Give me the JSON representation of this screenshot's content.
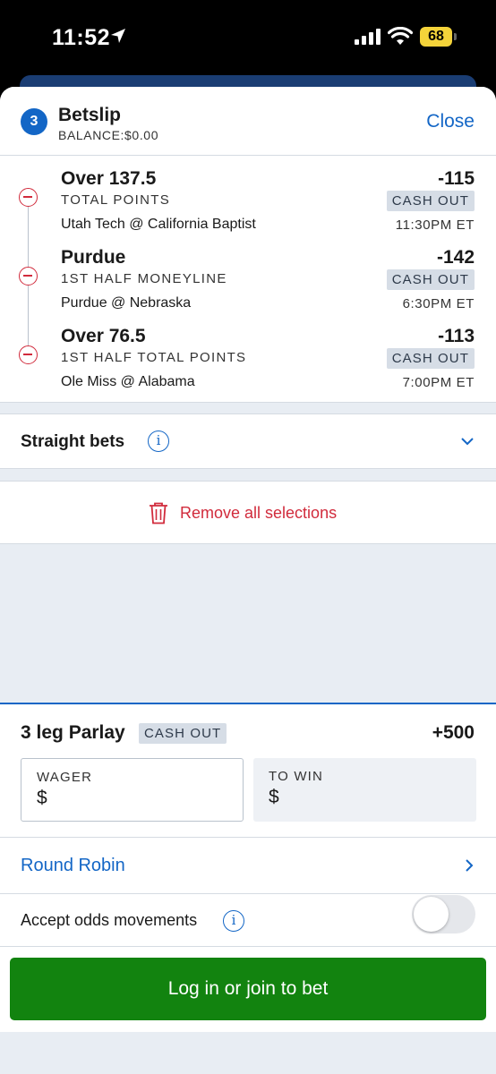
{
  "status_bar": {
    "time": "11:52",
    "battery": "68"
  },
  "betslip": {
    "count": "3",
    "title": "Betslip",
    "balance": "BALANCE:$0.00",
    "close_label": "Close"
  },
  "legs": [
    {
      "name": "Over 137.5",
      "market": "TOTAL POINTS",
      "game": "Utah Tech @ California Baptist",
      "odds": "-115",
      "cashout": "CASH OUT",
      "time": "11:30PM ET"
    },
    {
      "name": "Purdue",
      "market": "1ST HALF MONEYLINE",
      "game": "Purdue @ Nebraska",
      "odds": "-142",
      "cashout": "CASH OUT",
      "time": "6:30PM ET"
    },
    {
      "name": "Over 76.5",
      "market": "1ST HALF TOTAL POINTS",
      "game": "Ole Miss @ Alabama",
      "odds": "-113",
      "cashout": "CASH OUT",
      "time": "7:00PM ET"
    }
  ],
  "straight_bets": {
    "label": "Straight bets"
  },
  "remove_all": {
    "label": "Remove all selections"
  },
  "parlay": {
    "title": "3 leg Parlay",
    "cashout": "CASH OUT",
    "odds": "+500",
    "wager_label": "WAGER",
    "wager_value": "$",
    "towin_label": "TO WIN",
    "towin_value": "$"
  },
  "round_robin": {
    "label": "Round Robin"
  },
  "accept_odds": {
    "label": "Accept odds movements",
    "enabled": false
  },
  "login_button": {
    "label": "Log in or join to bet"
  },
  "colors": {
    "accent_blue": "#1366c6",
    "remove_red": "#d12b3c",
    "bet_green": "#12830f",
    "battery_yellow": "#f4d33a"
  }
}
